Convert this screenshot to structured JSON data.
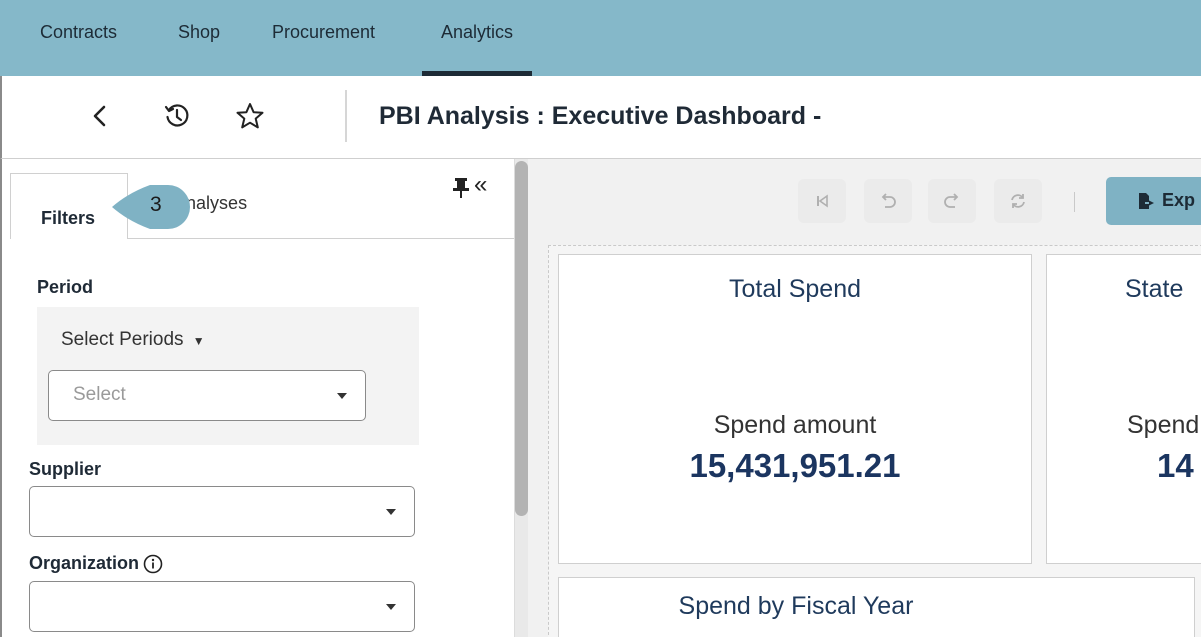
{
  "nav": {
    "tabs": [
      {
        "label": "Contracts"
      },
      {
        "label": "Shop"
      },
      {
        "label": "Procurement"
      },
      {
        "label": "Analytics",
        "active": true
      }
    ]
  },
  "header": {
    "title": "PBI Analysis : Executive Dashboard -"
  },
  "panel": {
    "tab_filters": "Filters",
    "tab_browse": "owse Analyses",
    "callout_number": "3",
    "period_label": "Period",
    "select_periods": "Select Periods",
    "select_placeholder": "Select",
    "supplier_label": "Supplier",
    "organization_label": "Organization"
  },
  "toolbar": {
    "export_label": "Exp"
  },
  "cards": {
    "total_spend": {
      "title": "Total Spend",
      "sub": "Spend amount",
      "value": "15,431,951.21"
    },
    "state": {
      "title": "State",
      "sub": "Spend",
      "value": "14"
    },
    "fiscal": {
      "title": "Spend by Fiscal Year"
    }
  },
  "colors": {
    "nav_bg": "#85b8c9",
    "accent_button": "#7fb2c4",
    "title_text": "#1f2a36",
    "value_text": "#1b3560"
  }
}
